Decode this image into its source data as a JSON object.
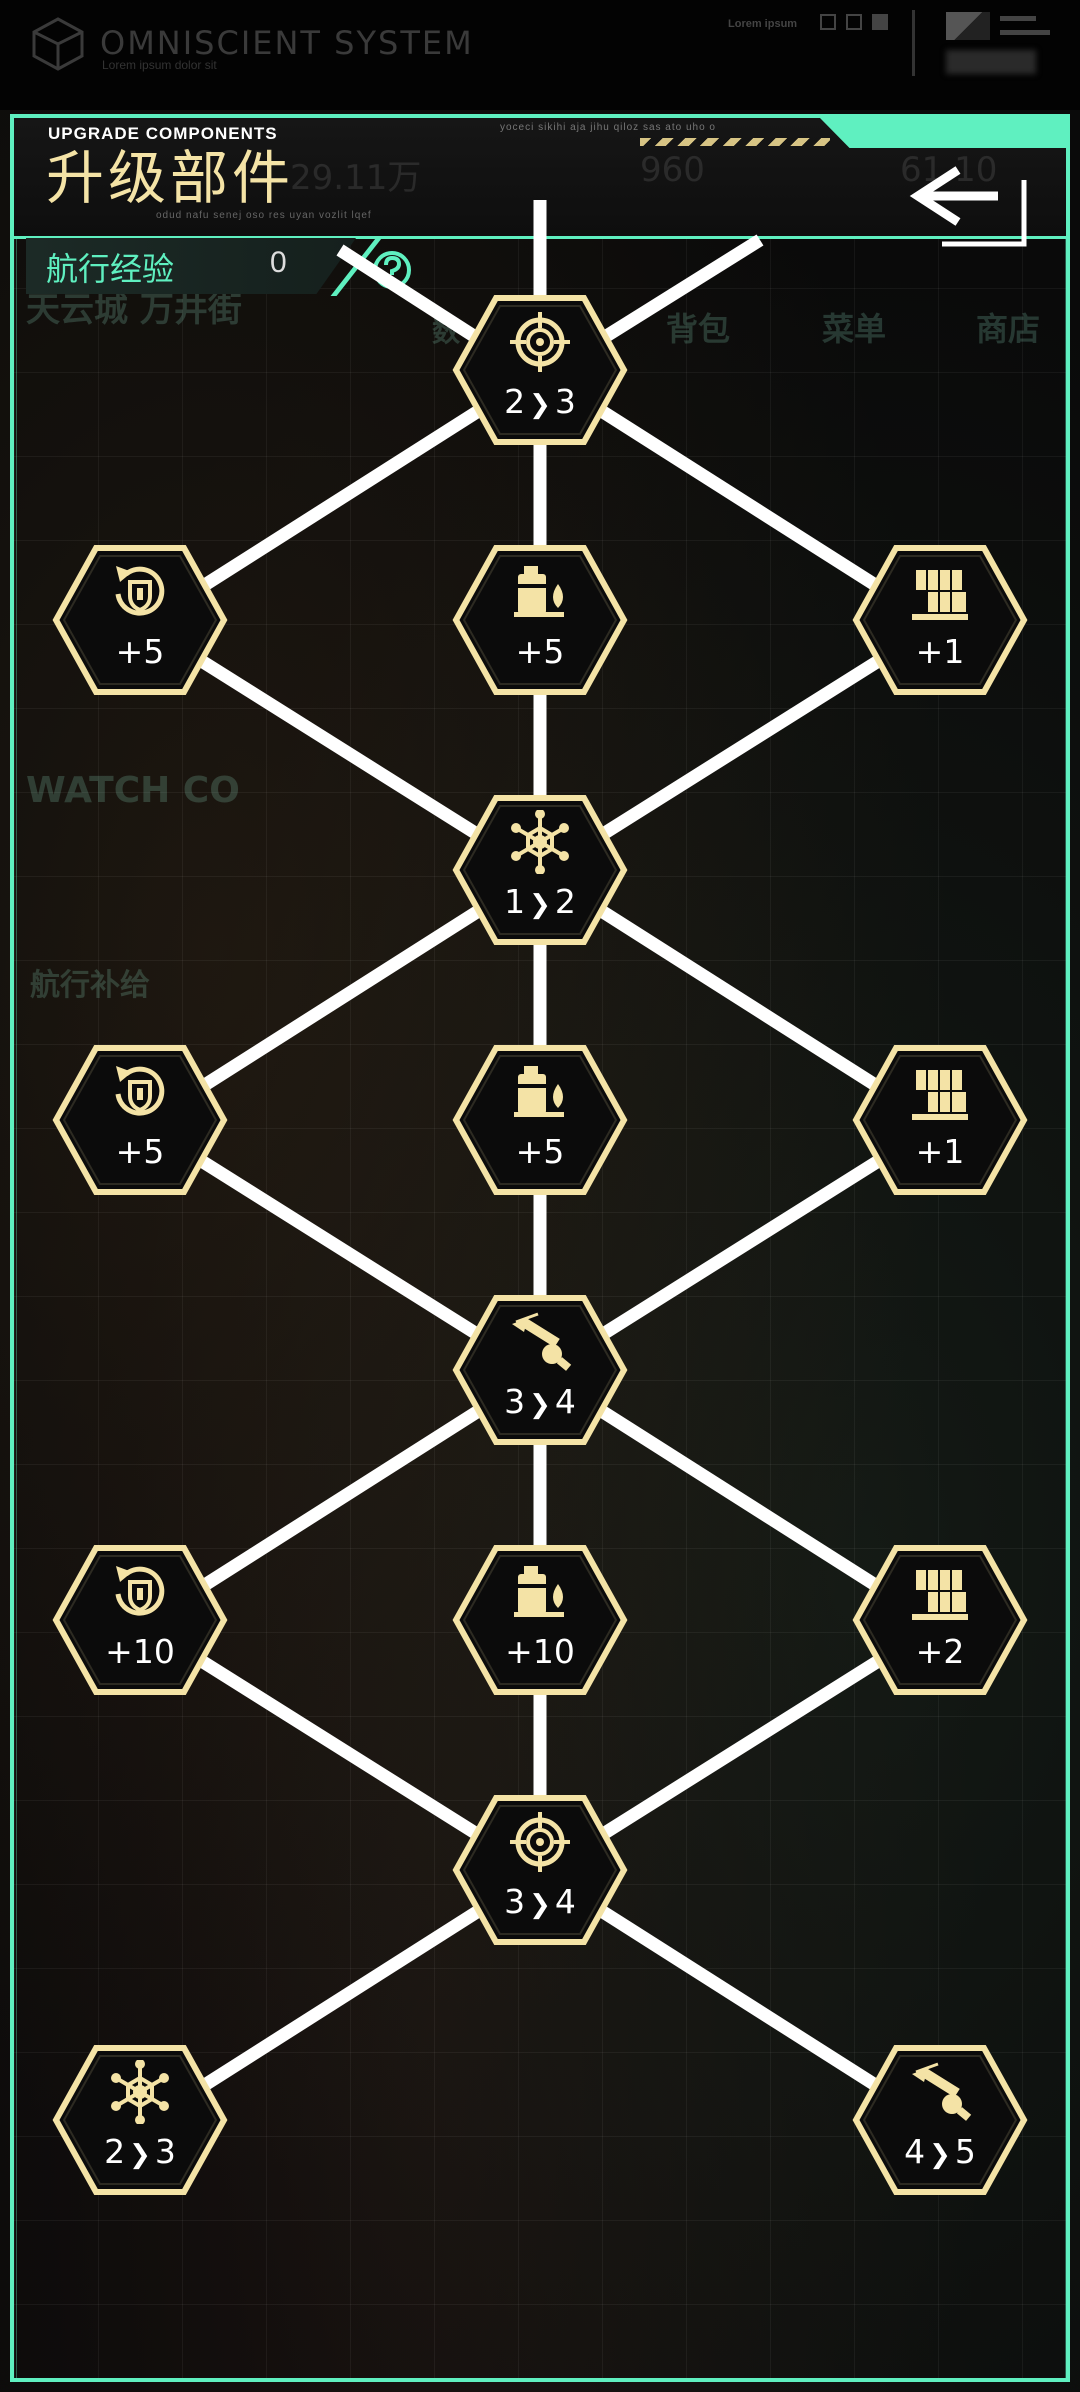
{
  "system_bar": {
    "title": "OMNISCIENT SYSTEM",
    "subtitle": "Lorem ipsum dolor sit",
    "right_label": "Lorem ipsum"
  },
  "header": {
    "title_en": "UPGRADE COMPONENTS",
    "title_cn": "升级部件",
    "tiny_text_top": "yoceci sikihi aja jihu qiloz sas ato uho o",
    "tiny_text_bottom": "odud nafu senej oso res uyan vozlit lqef",
    "ghost_texts": [
      "29.11万",
      "960",
      "61.10"
    ]
  },
  "background": {
    "texts": [
      "天云城 万井街",
      "背包",
      "菜单",
      "商店",
      "数",
      "WATCH CO",
      "航行补给"
    ]
  },
  "experience": {
    "label": "航行经验",
    "value": "0"
  },
  "colors": {
    "accent": "#5ff0c0",
    "hex_border": "#f4e3a6",
    "icon": "#f4e3a6",
    "line": "#ffffff"
  },
  "nodes": [
    {
      "name": "target-node-1",
      "icon": "target-icon",
      "from": "2",
      "to": "3",
      "type": "upgrade"
    },
    {
      "name": "shield-node-1",
      "icon": "shield-refresh-icon",
      "text": "+5",
      "type": "stat"
    },
    {
      "name": "fuel-node-1",
      "icon": "fuel-icon",
      "text": "+5",
      "type": "stat"
    },
    {
      "name": "cargo-node-1",
      "icon": "cargo-icon",
      "text": "+1",
      "type": "stat"
    },
    {
      "name": "web-node-1",
      "icon": "web-icon",
      "from": "1",
      "to": "2",
      "type": "upgrade"
    },
    {
      "name": "shield-node-2",
      "icon": "shield-refresh-icon",
      "text": "+5",
      "type": "stat"
    },
    {
      "name": "fuel-node-2",
      "icon": "fuel-icon",
      "text": "+5",
      "type": "stat"
    },
    {
      "name": "cargo-node-2",
      "icon": "cargo-icon",
      "text": "+1",
      "type": "stat"
    },
    {
      "name": "harpoon-node-1",
      "icon": "harpoon-icon",
      "from": "3",
      "to": "4",
      "type": "upgrade"
    },
    {
      "name": "shield-node-3",
      "icon": "shield-refresh-icon",
      "text": "+10",
      "type": "stat"
    },
    {
      "name": "fuel-node-3",
      "icon": "fuel-icon",
      "text": "+10",
      "type": "stat"
    },
    {
      "name": "cargo-node-3",
      "icon": "cargo-icon",
      "text": "+2",
      "type": "stat"
    },
    {
      "name": "target-node-2",
      "icon": "target-icon",
      "from": "3",
      "to": "4",
      "type": "upgrade"
    },
    {
      "name": "web-node-2",
      "icon": "web-icon",
      "from": "2",
      "to": "3",
      "type": "upgrade"
    },
    {
      "name": "harpoon-node-2",
      "icon": "harpoon-icon",
      "from": "4",
      "to": "5",
      "type": "upgrade"
    }
  ]
}
